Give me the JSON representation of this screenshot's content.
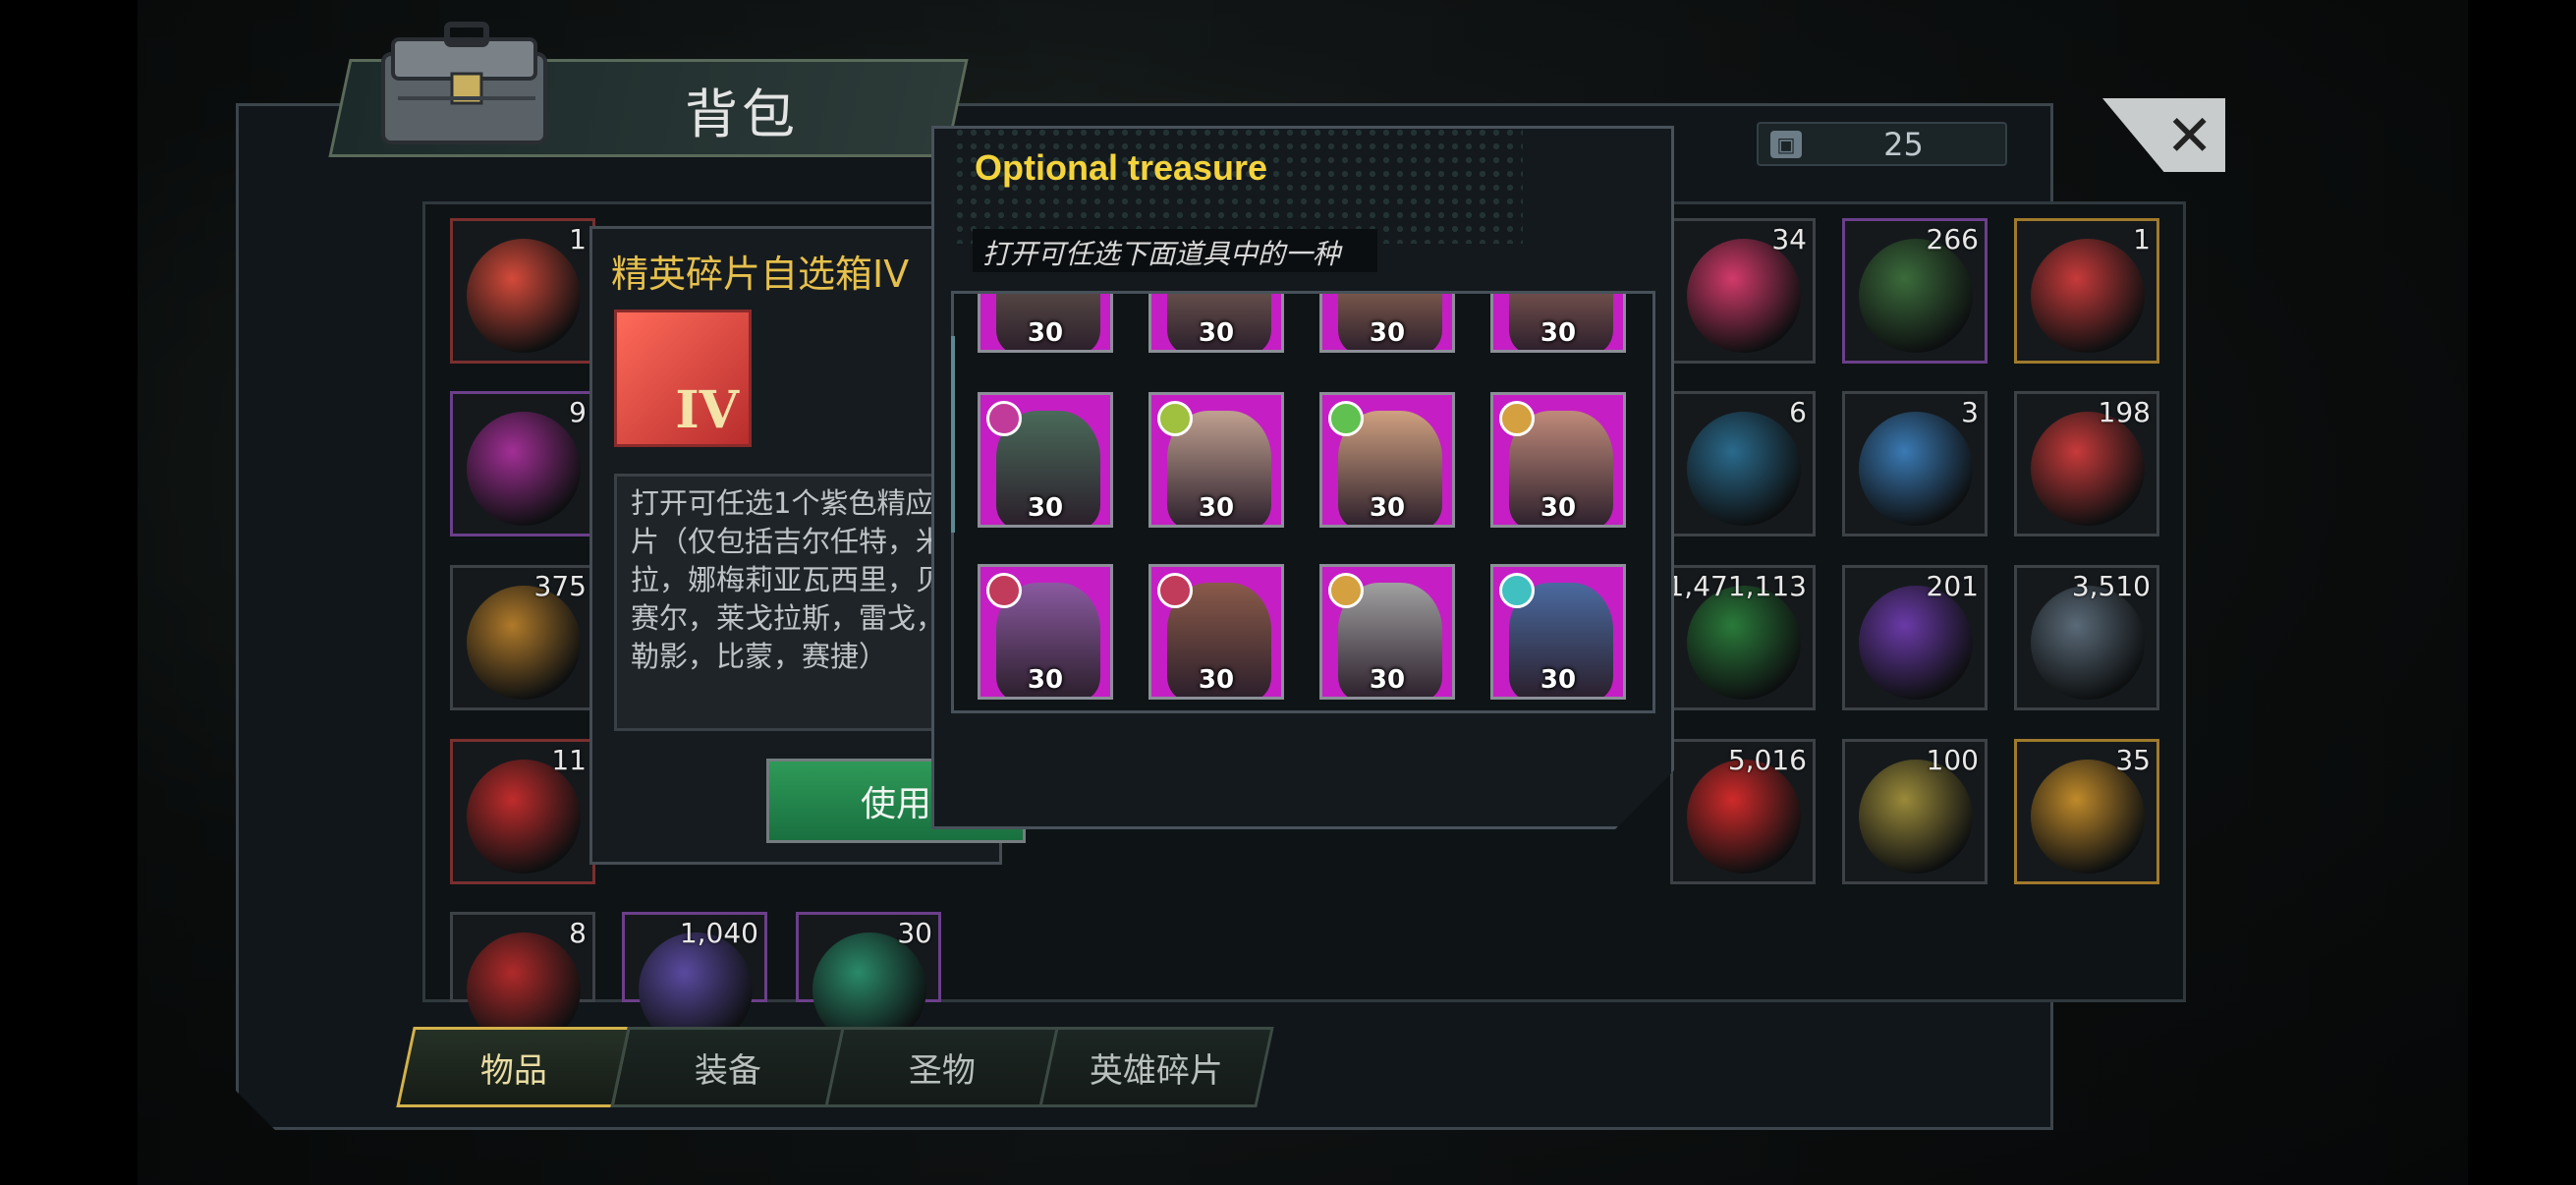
{
  "window": {
    "title": "背包",
    "capacity_count": "25",
    "close_label": "✕"
  },
  "grid_items": [
    {
      "count": "1",
      "color": "#d44a3a"
    },
    {
      "count": "34",
      "color": "#d23a6a"
    },
    {
      "count": "266",
      "color": "#3b6b3b"
    },
    {
      "count": "1",
      "color": "#c73a3a"
    },
    {
      "count": "9",
      "color": "#a22f96"
    },
    {
      "count": "6",
      "color": "#2a6a8c"
    },
    {
      "count": "3",
      "color": "#3a7ab4"
    },
    {
      "count": "198",
      "color": "#c73a3a"
    },
    {
      "count": "375",
      "color": "#b07a2a"
    },
    {
      "count": "1,471,113",
      "color": "#2a7a3a"
    },
    {
      "count": "201",
      "color": "#6a3aa8"
    },
    {
      "count": "3,510",
      "color": "#5a6a78"
    },
    {
      "count": "11",
      "color": "#c02c2c"
    },
    {
      "count": "5,016",
      "color": "#d02a2a"
    },
    {
      "count": "100",
      "color": "#9a8a3a"
    },
    {
      "count": "35",
      "color": "#c08a2a"
    },
    {
      "count": "8",
      "color": "#b02a2a"
    },
    {
      "count": "1,040",
      "color": "#5a4aa0"
    },
    {
      "count": "30",
      "color": "#2a8a6a"
    }
  ],
  "detail": {
    "name": "精英碎片自选箱IV",
    "icon_label": "IV",
    "description": "打开可任选1个紫色精应碎片（仅包括吉尔任特，米凯拉，娜梅莉亚瓦西里，贝金赛尔，莱戈拉斯，雷戈，米勒影，比蒙，赛捷）",
    "use_label": "使用"
  },
  "popup": {
    "title": "Optional treasure",
    "subtitle": "打开可任选下面道具中的一种",
    "heroes": [
      {
        "level": "30",
        "badge_color": "#b13bd2",
        "face": "#7a6a5a"
      },
      {
        "level": "30",
        "badge_color": "#a0c040",
        "face": "#9a7a6a"
      },
      {
        "level": "30",
        "badge_color": "#60c050",
        "face": "#c08a6a"
      },
      {
        "level": "30",
        "badge_color": "#d4a040",
        "face": "#b07a6a"
      },
      {
        "level": "30",
        "badge_color": "#c13b9a",
        "face": "#4a6a5a"
      },
      {
        "level": "30",
        "badge_color": "#a0c040",
        "face": "#c0a090"
      },
      {
        "level": "30",
        "badge_color": "#60c050",
        "face": "#d0a080"
      },
      {
        "level": "30",
        "badge_color": "#d4a040",
        "face": "#c08a7a"
      },
      {
        "level": "30",
        "badge_color": "#c13b5a",
        "face": "#8a5aa0"
      },
      {
        "level": "30",
        "badge_color": "#c13b5a",
        "face": "#8a5a4a"
      },
      {
        "level": "30",
        "badge_color": "#d4a040",
        "face": "#a0a0a0"
      },
      {
        "level": "30",
        "badge_color": "#40c0c0",
        "face": "#4a6aa0"
      }
    ]
  },
  "tabs": [
    {
      "label": "物品",
      "active": true
    },
    {
      "label": "装备",
      "active": false
    },
    {
      "label": "圣物",
      "active": false
    },
    {
      "label": "英雄碎片",
      "active": false
    }
  ]
}
